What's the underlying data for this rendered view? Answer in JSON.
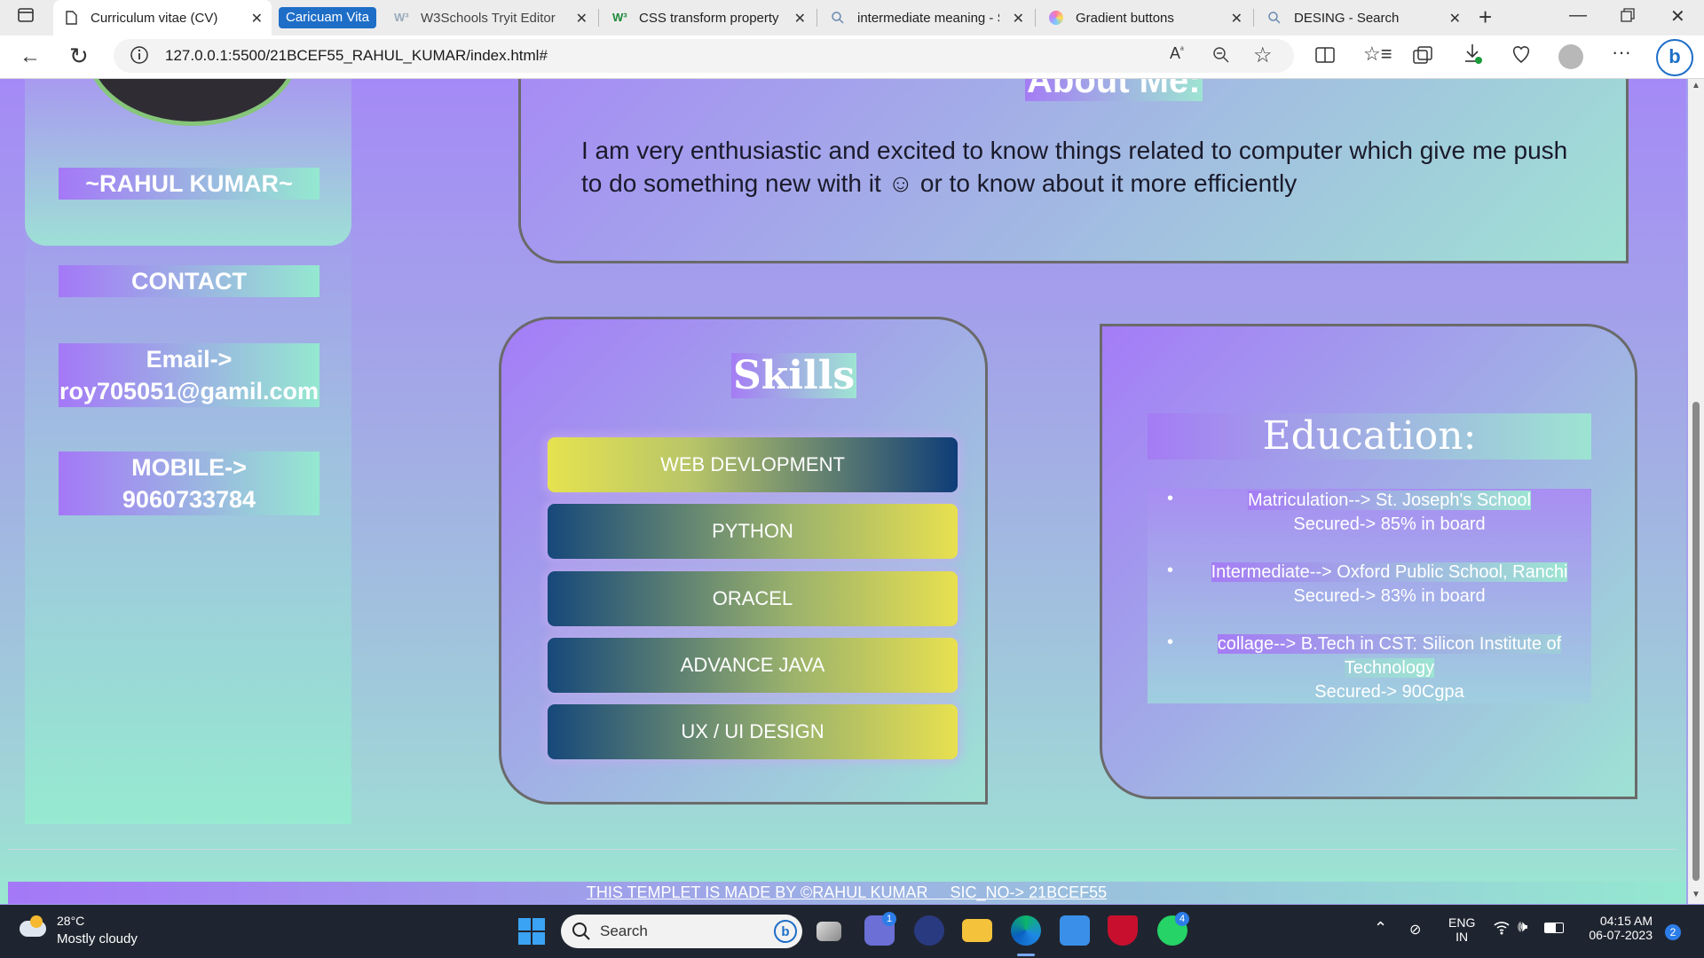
{
  "browser": {
    "tabs": [
      {
        "title": "Curriculum vitae (CV)",
        "active": true
      },
      {
        "title": "W3Schools Tryit Editor",
        "active": false
      },
      {
        "title": "CSS transform property",
        "active": false
      },
      {
        "title": "intermediate meaning - S",
        "active": false
      },
      {
        "title": "Gradient buttons",
        "active": false
      },
      {
        "title": "DESING - Search",
        "active": false
      }
    ],
    "tab_group_label": "Caricuam Vita",
    "url": "127.0.0.1:5500/21BCEF55_RAHUL_KUMAR/index.html#"
  },
  "sidebar": {
    "name": "~RAHUL KUMAR~",
    "contact_heading": "CONTACT",
    "email_label": "Email->",
    "email_value": "roy705051@gamil.com",
    "mobile_label": "MOBILE->",
    "mobile_value": "9060733784"
  },
  "about": {
    "title": "About Me:",
    "text": "I am very enthusiastic and excited to know things related to computer which give me push to do something new with it ☺ or to know about it more efficiently"
  },
  "skills": {
    "title": "Skills",
    "items": [
      "WEB DEVLOPMENT",
      "PYTHON",
      "ORACEL",
      "ADVANCE JAVA",
      "UX / UI DESIGN"
    ]
  },
  "education": {
    "title": "Education:",
    "items": [
      {
        "line1": "Matriculation--> St. Joseph's School",
        "line2": "Secured-> 85% in board"
      },
      {
        "line1": "Intermediate--> Oxford Public School, Ranchi",
        "line2": "Secured-> 83% in board"
      },
      {
        "line1": "collage--> B.Tech in CST: Silicon Institute of Technology",
        "line2": "Secured-> 90Cgpa"
      }
    ]
  },
  "footer": {
    "text": "THIS TEMPLET IS MADE BY ©RAHUL KUMAR     SIC_NO-> 21BCEF55"
  },
  "taskbar": {
    "weather_temp": "28°C",
    "weather_desc": "Mostly cloudy",
    "search_placeholder": "Search",
    "teams_badge": "1",
    "whatsapp_badge": "4",
    "lang_line1": "ENG",
    "lang_line2": "IN",
    "time": "04:15 AM",
    "date": "06-07-2023",
    "notification_count": "2"
  },
  "colors": {
    "tab_group": "#1e6ec8",
    "page_top": "#a48af6",
    "page_bottom": "#99e8d0",
    "skill_yellow": "#e6e350",
    "skill_blue": "#0f3d78"
  }
}
